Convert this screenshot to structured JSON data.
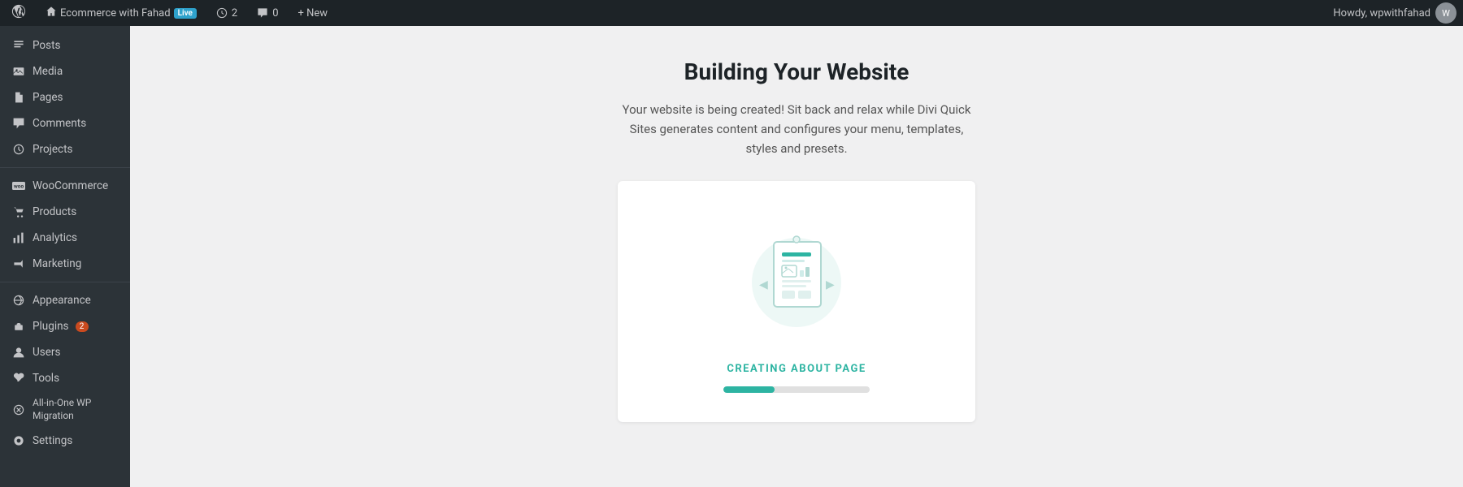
{
  "adminBar": {
    "siteName": "Ecommerce with Fahad",
    "liveBadge": "Live",
    "revisions": "2",
    "comments": "0",
    "newLabel": "+ New",
    "howdy": "Howdy, wpwithfahad"
  },
  "sidebar": {
    "items": [
      {
        "id": "posts",
        "label": "Posts",
        "icon": "posts-icon"
      },
      {
        "id": "media",
        "label": "Media",
        "icon": "media-icon"
      },
      {
        "id": "pages",
        "label": "Pages",
        "icon": "pages-icon"
      },
      {
        "id": "comments",
        "label": "Comments",
        "icon": "comments-icon"
      },
      {
        "id": "projects",
        "label": "Projects",
        "icon": "projects-icon"
      },
      {
        "id": "woocommerce",
        "label": "WooCommerce",
        "icon": "woo-icon"
      },
      {
        "id": "products",
        "label": "Products",
        "icon": "products-icon"
      },
      {
        "id": "analytics",
        "label": "Analytics",
        "icon": "analytics-icon"
      },
      {
        "id": "marketing",
        "label": "Marketing",
        "icon": "marketing-icon"
      },
      {
        "id": "appearance",
        "label": "Appearance",
        "icon": "appearance-icon"
      },
      {
        "id": "plugins",
        "label": "Plugins",
        "icon": "plugins-icon",
        "badge": "2"
      },
      {
        "id": "users",
        "label": "Users",
        "icon": "users-icon"
      },
      {
        "id": "tools",
        "label": "Tools",
        "icon": "tools-icon"
      },
      {
        "id": "all-in-one",
        "label": "All-in-One WP Migration",
        "icon": "migration-icon"
      },
      {
        "id": "settings",
        "label": "Settings",
        "icon": "settings-icon"
      }
    ]
  },
  "main": {
    "title": "Building Your Website",
    "subtitle": "Your website is being created! Sit back and relax while Divi Quick Sites generates content and configures your menu, templates, styles and presets.",
    "card": {
      "creatingLabel": "CREATING ABOUT PAGE",
      "progressPercent": 35
    }
  }
}
